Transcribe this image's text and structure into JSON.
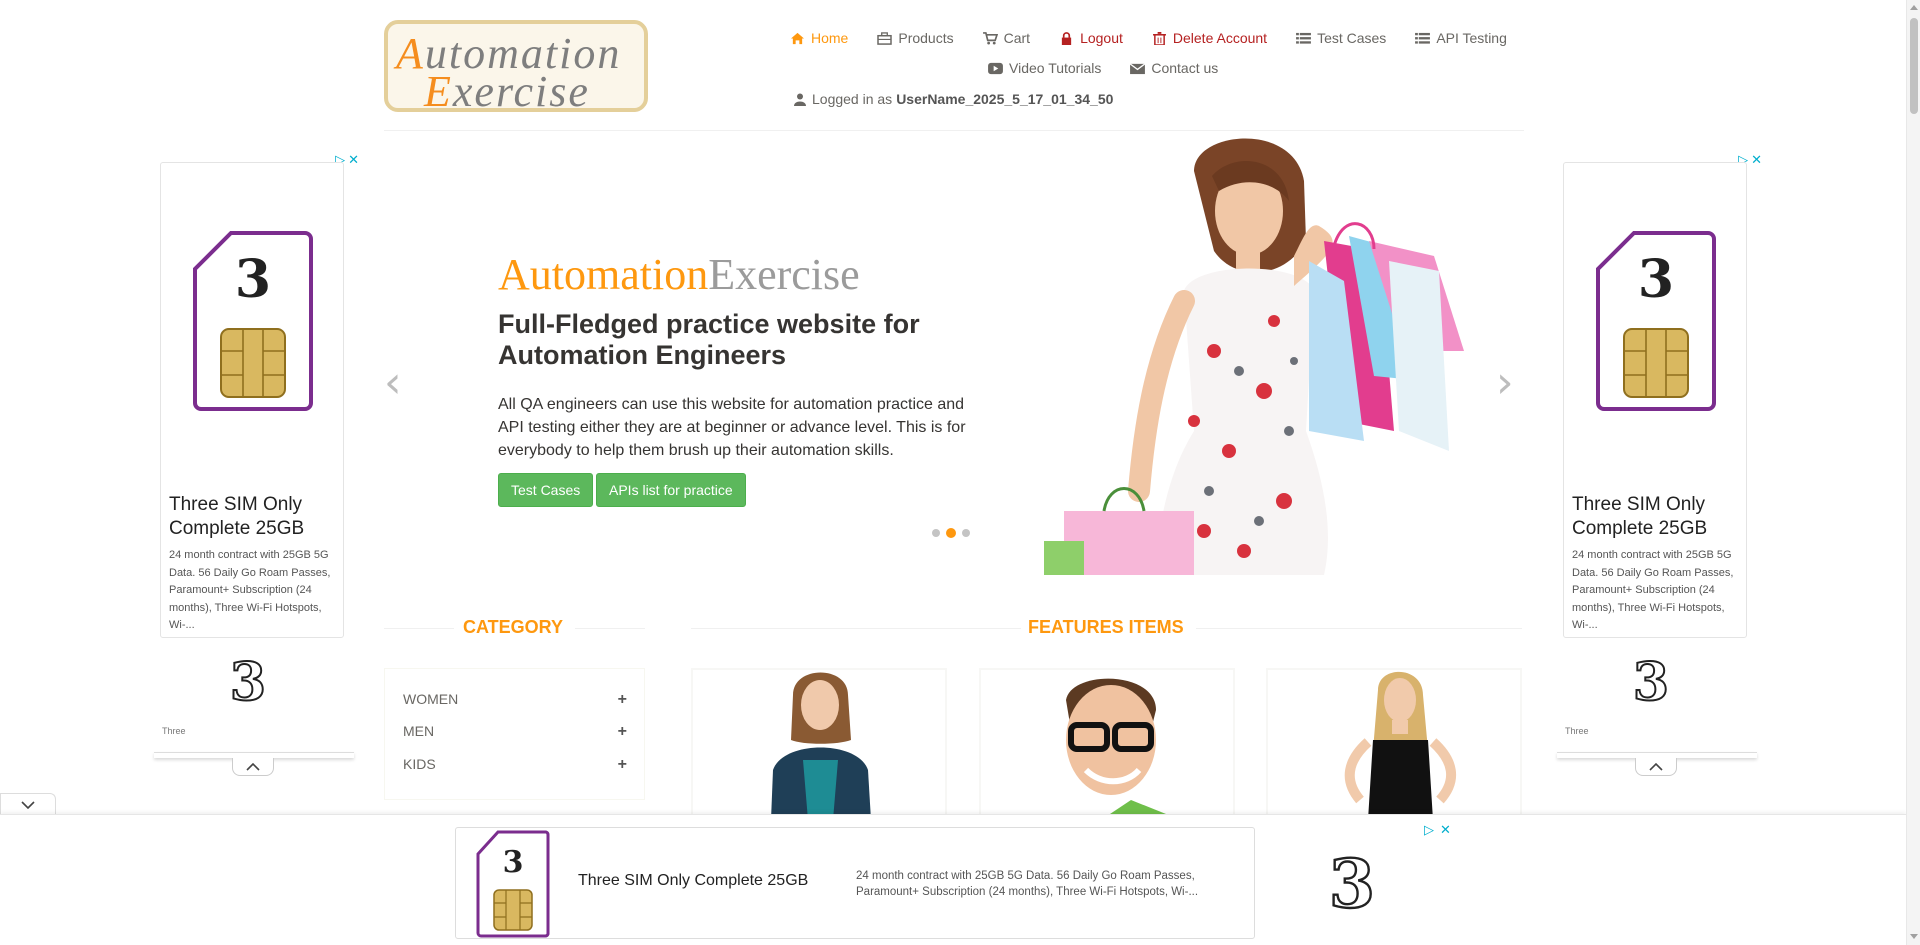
{
  "logo": {
    "line1_cap": "A",
    "line1_rest": "utomation",
    "line2_cap": "E",
    "line2_rest": "xercise"
  },
  "nav": {
    "items": [
      {
        "label": "Home",
        "icon": "home-icon"
      },
      {
        "label": "Products",
        "icon": "products-icon"
      },
      {
        "label": "Cart",
        "icon": "cart-icon"
      },
      {
        "label": "Logout",
        "icon": "lock-icon"
      },
      {
        "label": "Delete Account",
        "icon": "trash-icon"
      },
      {
        "label": "Test Cases",
        "icon": "list-icon"
      },
      {
        "label": "API Testing",
        "icon": "list-icon"
      },
      {
        "label": "Video Tutorials",
        "icon": "youtube-icon"
      },
      {
        "label": "Contact us",
        "icon": "envelope-icon"
      }
    ],
    "logged_prefix": "Logged in as",
    "username": "UserName_2025_5_17_01_34_50"
  },
  "colors": {
    "accent": "#fe980f",
    "danger": "#b52121",
    "button": "#5cb85c",
    "ad_purple": "#7b2d8e"
  },
  "slider": {
    "brand_a": "Automation",
    "brand_b": "Exercise",
    "heading": "Full-Fledged practice website for Automation Engineers",
    "paragraph": "All QA engineers can use this website for automation practice and API testing either they are at beginner or advance level. This is for everybody to help them brush up their automation skills.",
    "btn_test_cases": "Test Cases",
    "btn_apis": "APIs list for practice",
    "prev": "‹",
    "next": "›",
    "active_dot": 2,
    "dot_count": 3
  },
  "side_ad": {
    "headline": "Three SIM Only Complete 25GB",
    "description": "24 month contract with 25GB 5G Data. 56 Daily Go Roam Passes, Paramount+ Subscription (24 months), Three Wi-Fi Hotspots, Wi-...",
    "advertiser": "Three"
  },
  "category": {
    "title": "CATEGORY",
    "items": [
      {
        "label": "WOMEN"
      },
      {
        "label": "MEN"
      },
      {
        "label": "KIDS"
      }
    ],
    "expand_symbol": "+"
  },
  "features": {
    "title": "FEATURES ITEMS"
  },
  "bottom_ad": {
    "headline": "Three SIM Only Complete 25GB",
    "description": "24 month contract with 25GB 5G Data. 56 Daily Go Roam Passes, Paramount+ Subscription (24 months), Three Wi-Fi Hotspots, Wi-..."
  }
}
